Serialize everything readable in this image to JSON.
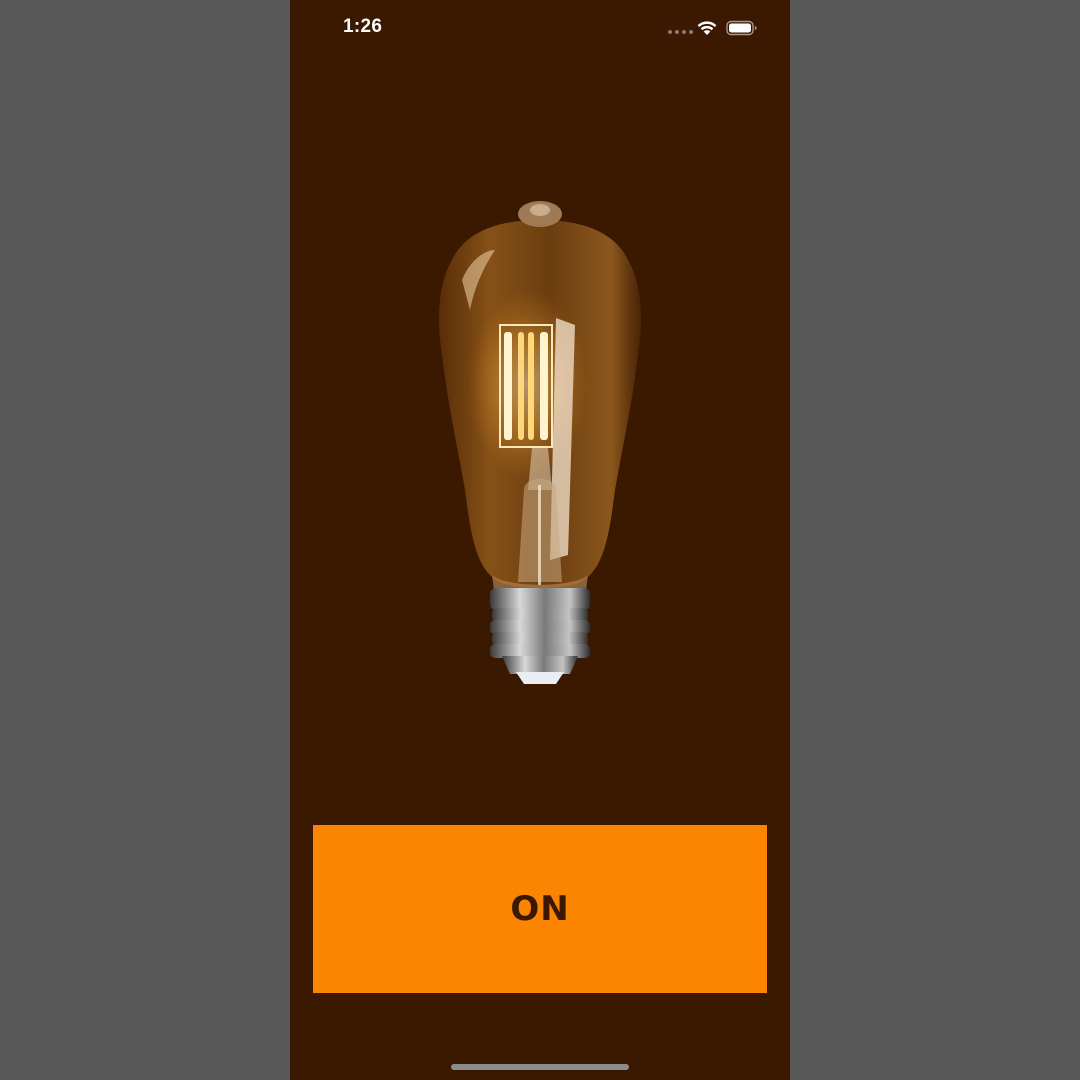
{
  "status_bar": {
    "time": "1:26"
  },
  "toggle": {
    "label": "ON"
  },
  "colors": {
    "background": "#3b1800",
    "button": "#fb8500",
    "button_text": "#3b1800",
    "outer": "#585858"
  },
  "icons": {
    "wifi": "wifi-icon",
    "battery": "battery-icon",
    "bulb": "light-bulb-image"
  }
}
